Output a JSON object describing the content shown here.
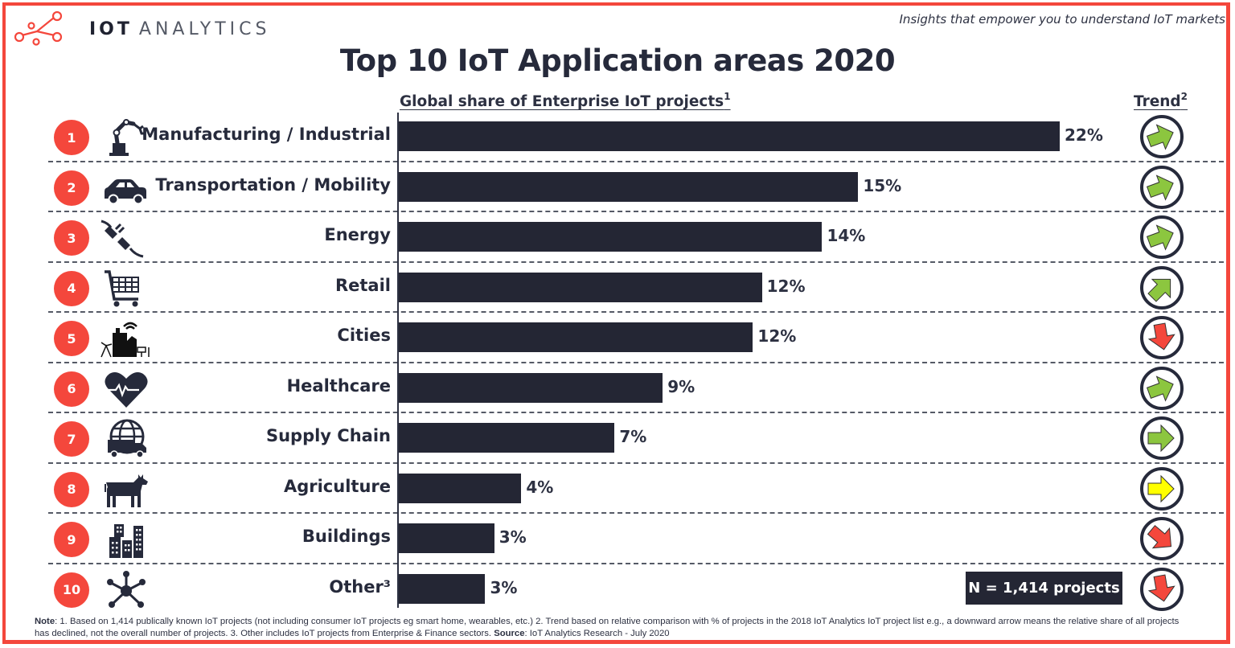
{
  "header": {
    "logo_bold": "IOT",
    "logo_light": "ANALYTICS",
    "tagline": "Insights that empower you to understand IoT markets"
  },
  "colors": {
    "accent_red": "#f4473c",
    "bar_dark": "#242634",
    "trend_up": "#8cc63f",
    "trend_flat": "#ffff00",
    "trend_down": "#f4473c"
  },
  "chart_data": {
    "type": "bar",
    "orientation": "horizontal",
    "title": "Top 10 IoT Application areas 2020",
    "subtitle": "Global share of Enterprise IoT projects",
    "subtitle_footnote": "1",
    "trend_header": "Trend",
    "trend_footnote": "2",
    "xlabel": "",
    "ylabel": "",
    "xlim": [
      0,
      22
    ],
    "grid": false,
    "categories": [
      "Manufacturing / Industrial",
      "Transportation / Mobility",
      "Energy",
      "Retail",
      "Cities",
      "Healthcare",
      "Supply Chain",
      "Agriculture",
      "Buildings",
      "Other³"
    ],
    "ranks": [
      "1",
      "2",
      "3",
      "4",
      "5",
      "6",
      "7",
      "8",
      "9",
      "10"
    ],
    "values": [
      22,
      15,
      14,
      12,
      12,
      9,
      7,
      4,
      3,
      3
    ],
    "bar_values_estimated": [
      22,
      15.3,
      14.1,
      12.1,
      11.8,
      8.8,
      7.2,
      4.1,
      3.2,
      2.9
    ],
    "value_labels": [
      "22%",
      "15%",
      "14%",
      "12%",
      "12%",
      "9%",
      "7%",
      "4%",
      "3%",
      "3%"
    ],
    "icons": [
      "robot-arm-icon",
      "car-icon",
      "plug-icon",
      "shopping-cart-icon",
      "city-icon",
      "heart-pulse-icon",
      "globe-truck-icon",
      "cow-icon",
      "buildings-icon",
      "network-hub-icon"
    ],
    "trends": [
      "up-right",
      "up-right",
      "up-right",
      "up",
      "down",
      "up-right",
      "right",
      "right-flat",
      "down-right",
      "down"
    ],
    "sample_size": "N = 1,414 projects"
  },
  "footer": {
    "note_label": "Note",
    "note_line1": ": 1. Based on 1,414 publically known IoT projects (not including consumer IoT projects eg smart home, wearables, etc.) 2. Trend based on relative comparison with % of projects in the 2018 IoT Analytics IoT project list e.g., a downward arrow means the relative share of all projects has declined, not the overall number of projects. 3. Other includes IoT projects from Enterprise & Finance sectors.  ",
    "source_label": "Source",
    "source_text": ": IoT Analytics Research - July 2020"
  }
}
